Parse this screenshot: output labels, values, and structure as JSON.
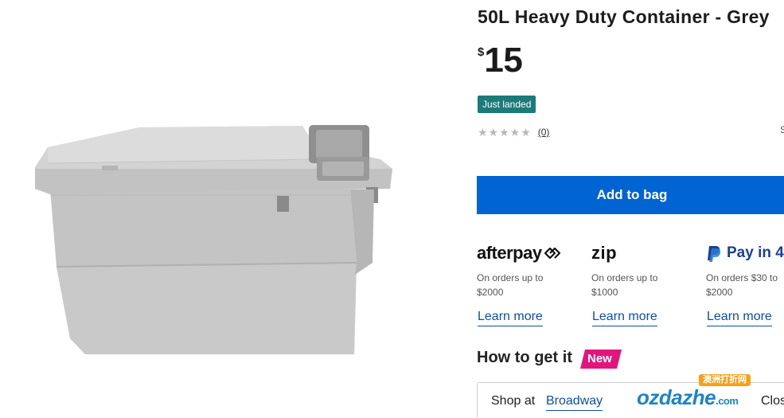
{
  "product": {
    "title": "50L Heavy Duty Container - Grey",
    "price_currency": "$",
    "price_amount": "15",
    "badge": "Just landed",
    "rating": {
      "stars": 0,
      "max_stars": 5,
      "review_count": "(0)"
    },
    "image_alt": "grey storage container with latched lid",
    "body_color": "#c9c9c9"
  },
  "actions": {
    "add_to_bag": "Add to bag"
  },
  "payments": [
    {
      "brand": "afterpay",
      "desc_line1": "On orders up to",
      "desc_line2": "$2000",
      "learn_more": "Learn more"
    },
    {
      "brand": "zip",
      "desc_line1": "On orders up to",
      "desc_line2": "$1000",
      "learn_more": "Learn more"
    },
    {
      "brand": "Pay in 4",
      "desc_line1": "On orders $30 to",
      "desc_line2": "$2000",
      "learn_more": "Learn more"
    }
  ],
  "fulfilment": {
    "title": "How to get it",
    "new_tag": "New",
    "shop_at_label": "Shop at",
    "store_name": "Broadway",
    "store_status": "Clos"
  },
  "edge": {
    "right_mark": "S"
  },
  "watermark": {
    "top_text": "澳洲打折网",
    "logo_text": "ozdazhe",
    "logo_suffix": ".com"
  },
  "colors": {
    "accent": "#0064d2",
    "badge": "#1c7b78",
    "new_tag": "#e3147d",
    "link": "#0b4fa3",
    "paypal": "#1c3f94"
  }
}
